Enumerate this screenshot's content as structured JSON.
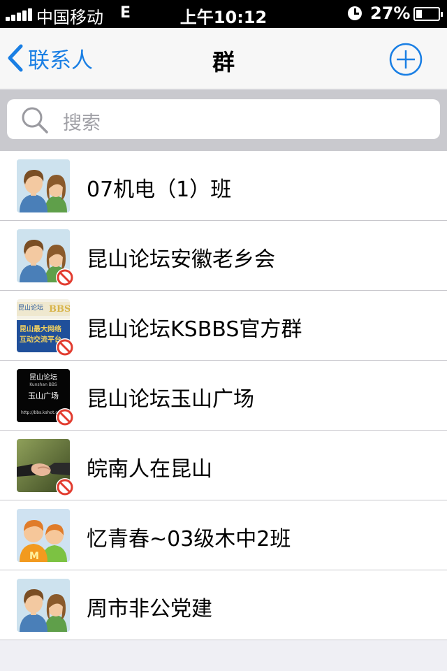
{
  "status_bar": {
    "carrier": "中国移动",
    "network": "E",
    "time": "上午10:12",
    "battery_percent": "27%"
  },
  "nav": {
    "back_label": "联系人",
    "title": "群",
    "accent_color": "#1a7fe4"
  },
  "search": {
    "placeholder": "搜索"
  },
  "groups": [
    {
      "name": "07机电（1）班",
      "avatar": "couple-avatar-icon",
      "blocked": false
    },
    {
      "name": "昆山论坛安徽老乡会",
      "avatar": "couple-avatar-icon",
      "blocked": true
    },
    {
      "name": "昆山论坛KSBBS官方群",
      "avatar": "ksbbs-logo-icon",
      "blocked": true,
      "avatar_text": [
        "昆山论坛",
        "昆山最大网络",
        "互动交流平台"
      ]
    },
    {
      "name": "昆山论坛玉山广场",
      "avatar": "yushan-square-logo-icon",
      "blocked": true,
      "avatar_text": [
        "昆山论坛",
        "Kunshan BBS",
        "玉山广场",
        "http://bbs.kshot.c"
      ]
    },
    {
      "name": "皖南人在昆山",
      "avatar": "handshake-icon",
      "blocked": true
    },
    {
      "name": "忆青春~03级木中2班",
      "avatar": "cartoon-couple-icon",
      "blocked": false
    },
    {
      "name": "周市非公党建",
      "avatar": "couple-avatar-icon",
      "blocked": false
    }
  ]
}
